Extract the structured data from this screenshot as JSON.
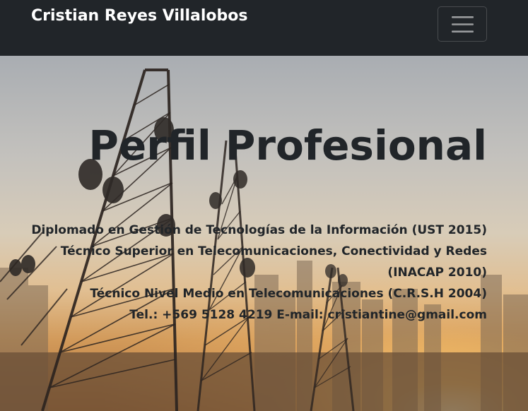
{
  "navbar": {
    "brand": "Cristian Reyes Villalobos",
    "toggler_icon": "hamburger-menu-icon"
  },
  "hero": {
    "title": "Perfil Profesional",
    "background_icon": "telecom-towers-photo",
    "lines": [
      "Diplomado en Gestión de Tecnologías de la Información (UST 2015)",
      "Técnico Superior en Telecomunicaciones, Conectividad y Redes (INACAP 2010)",
      "Técnico Nivel Medio en Telecomunicaciones (C.R.S.H 2004)"
    ],
    "contact": {
      "phone_label": "Tel.: +569 5128 4219",
      "email_label": "E-mail:",
      "email": "cristiantine@gmail.com"
    }
  },
  "colors": {
    "navbar_bg": "#212529",
    "text_dark": "#212529",
    "brand_text": "#ffffff"
  }
}
